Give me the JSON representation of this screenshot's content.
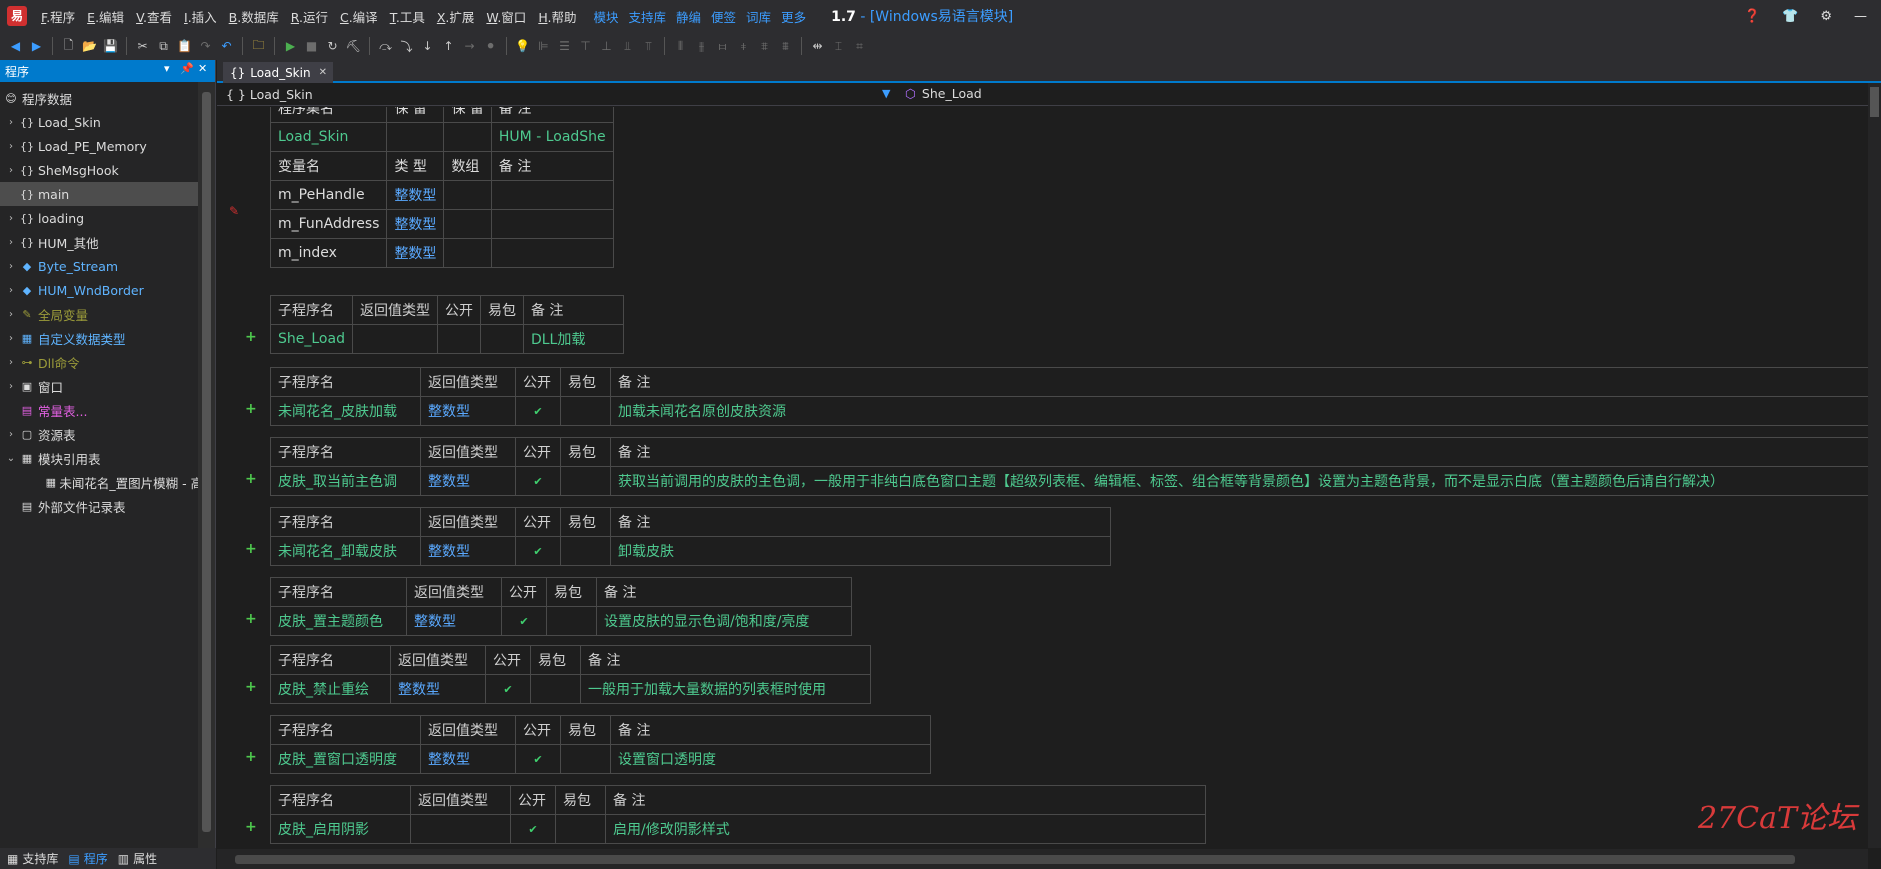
{
  "menubar": {
    "items": [
      {
        "key": "F",
        "label": ".程序"
      },
      {
        "key": "E",
        "label": ".编辑"
      },
      {
        "key": "V",
        "label": ".查看"
      },
      {
        "key": "I",
        "label": ".插入"
      },
      {
        "key": "B",
        "label": ".数据库"
      },
      {
        "key": "R",
        "label": ".运行"
      },
      {
        "key": "C",
        "label": ".编译"
      },
      {
        "key": "T",
        "label": ".工具"
      },
      {
        "key": "X",
        "label": ".扩展"
      },
      {
        "key": "W",
        "label": ".窗口"
      },
      {
        "key": "H",
        "label": ".帮助"
      }
    ],
    "links": [
      "模块",
      "支持库",
      "静编",
      "便签",
      "词库",
      "更多"
    ],
    "version": "1.7",
    "title": " - [Windows易语言模块]"
  },
  "left_panel": {
    "title": "程序",
    "tree": [
      {
        "arrow": "",
        "icon": "😊",
        "label": "程序数据",
        "color": "#dcdcdc",
        "indent": 0
      },
      {
        "arrow": "›",
        "icon": "{}",
        "label": "Load_Skin",
        "color": "#dcdcdc",
        "indent": 1
      },
      {
        "arrow": "›",
        "icon": "{}",
        "label": "Load_PE_Memory",
        "color": "#dcdcdc",
        "indent": 1
      },
      {
        "arrow": "›",
        "icon": "{}",
        "label": "SheMsgHook",
        "color": "#dcdcdc",
        "indent": 1
      },
      {
        "arrow": "",
        "icon": "{}",
        "label": "main",
        "color": "#dcdcdc",
        "indent": 1,
        "selected": true
      },
      {
        "arrow": "›",
        "icon": "{}",
        "label": "loading",
        "color": "#dcdcdc",
        "indent": 1
      },
      {
        "arrow": "›",
        "icon": "{}",
        "label": "HUM_其他",
        "color": "#dcdcdc",
        "indent": 1
      },
      {
        "arrow": "›",
        "icon": "◆",
        "label": "Byte_Stream",
        "color": "#5fb4ff",
        "indent": 1
      },
      {
        "arrow": "›",
        "icon": "◆",
        "label": "HUM_WndBorder",
        "color": "#5fb4ff",
        "indent": 1
      },
      {
        "arrow": "›",
        "icon": "✎",
        "label": "全局变量",
        "color": "#9c9c3a",
        "indent": 1
      },
      {
        "arrow": "›",
        "icon": "▦",
        "label": "自定义数据类型",
        "color": "#5fb4ff",
        "indent": 1
      },
      {
        "arrow": "›",
        "icon": "⊶",
        "label": "Dll命令",
        "color": "#9c9c3a",
        "indent": 1
      },
      {
        "arrow": "›",
        "icon": "▣",
        "label": "窗口",
        "color": "#dcdcdc",
        "indent": 1
      },
      {
        "arrow": "",
        "icon": "▤",
        "label": "常量表...",
        "color": "#e060e0",
        "indent": 1
      },
      {
        "arrow": "›",
        "icon": "▢",
        "label": "资源表",
        "color": "#dcdcdc",
        "indent": 1
      },
      {
        "arrow": "⌄",
        "icon": "▦",
        "label": "模块引用表",
        "color": "#dcdcdc",
        "indent": 1
      },
      {
        "arrow": "",
        "icon": "▦",
        "label": "未闻花名_置图片模糊 - 高...",
        "color": "#dcdcdc",
        "indent": 2
      },
      {
        "arrow": "",
        "icon": "▤",
        "label": "外部文件记录表",
        "color": "#dcdcdc",
        "indent": 1
      }
    ]
  },
  "bottom_tabs": [
    {
      "icon": "▦",
      "label": "支持库"
    },
    {
      "icon": "▤",
      "label": "程序",
      "active": true
    },
    {
      "icon": "▥",
      "label": "属性"
    }
  ],
  "editor_tab": {
    "label": "Load_Skin",
    "icon": "{}"
  },
  "navbar": {
    "left": "{ } Load_Skin",
    "right": "She_Load"
  },
  "assembly_table": {
    "header1": [
      "程序集名",
      "保 留",
      "保 留",
      "备 注"
    ],
    "row1": [
      "Load_Skin",
      "",
      "",
      "HUM - LoadShe"
    ],
    "header2": [
      "变量名",
      "类 型",
      "数组",
      "备 注"
    ],
    "vars": [
      [
        "m_PeHandle",
        "整数型",
        "",
        ""
      ],
      [
        "m_FunAddress",
        "整数型",
        "",
        ""
      ],
      [
        "m_index",
        "整数型",
        "",
        ""
      ]
    ]
  },
  "subs": [
    {
      "header": [
        "子程序名",
        "返回值类型",
        "公开",
        "易包",
        "备 注"
      ],
      "name": "She_Load",
      "ret": "",
      "pub": "",
      "pkg": "",
      "remark": "DLL加载"
    },
    {
      "header": [
        "子程序名",
        "返回值类型",
        "公开",
        "易包",
        "备 注"
      ],
      "name": "未闻花名_皮肤加载",
      "ret": "整数型",
      "pub": "✔",
      "pkg": "",
      "remark": "加载未闻花名原创皮肤资源"
    },
    {
      "header": [
        "子程序名",
        "返回值类型",
        "公开",
        "易包",
        "备 注"
      ],
      "name": "皮肤_取当前主色调",
      "ret": "整数型",
      "pub": "✔",
      "pkg": "",
      "remark": "获取当前调用的皮肤的主色调，一般用于非纯白底色窗口主题【超级列表框、编辑框、标签、组合框等背景颜色】设置为主题色背景，而不是显示白底（置主题颜色后请自行解决）"
    },
    {
      "header": [
        "子程序名",
        "返回值类型",
        "公开",
        "易包",
        "备 注"
      ],
      "name": "未闻花名_卸载皮肤",
      "ret": "整数型",
      "pub": "✔",
      "pkg": "",
      "remark": "卸载皮肤"
    },
    {
      "header": [
        "子程序名",
        "返回值类型",
        "公开",
        "易包",
        "备 注"
      ],
      "name": "皮肤_置主题颜色",
      "ret": "整数型",
      "pub": "✔",
      "pkg": "",
      "remark": "设置皮肤的显示色调/饱和度/亮度"
    },
    {
      "header": [
        "子程序名",
        "返回值类型",
        "公开",
        "易包",
        "备 注"
      ],
      "name": "皮肤_禁止重绘",
      "ret": "整数型",
      "pub": "✔",
      "pkg": "",
      "remark": "一般用于加载大量数据的列表框时使用"
    },
    {
      "header": [
        "子程序名",
        "返回值类型",
        "公开",
        "易包",
        "备 注"
      ],
      "name": "皮肤_置窗口透明度",
      "ret": "整数型",
      "pub": "✔",
      "pkg": "",
      "remark": "设置窗口透明度"
    },
    {
      "header": [
        "子程序名",
        "返回值类型",
        "公开",
        "易包",
        "备 注"
      ],
      "name": "皮肤_启用阴影",
      "ret": "",
      "pub": "✔",
      "pkg": "",
      "remark": "启用/修改阴影样式"
    }
  ],
  "watermark": "27CaT论坛"
}
